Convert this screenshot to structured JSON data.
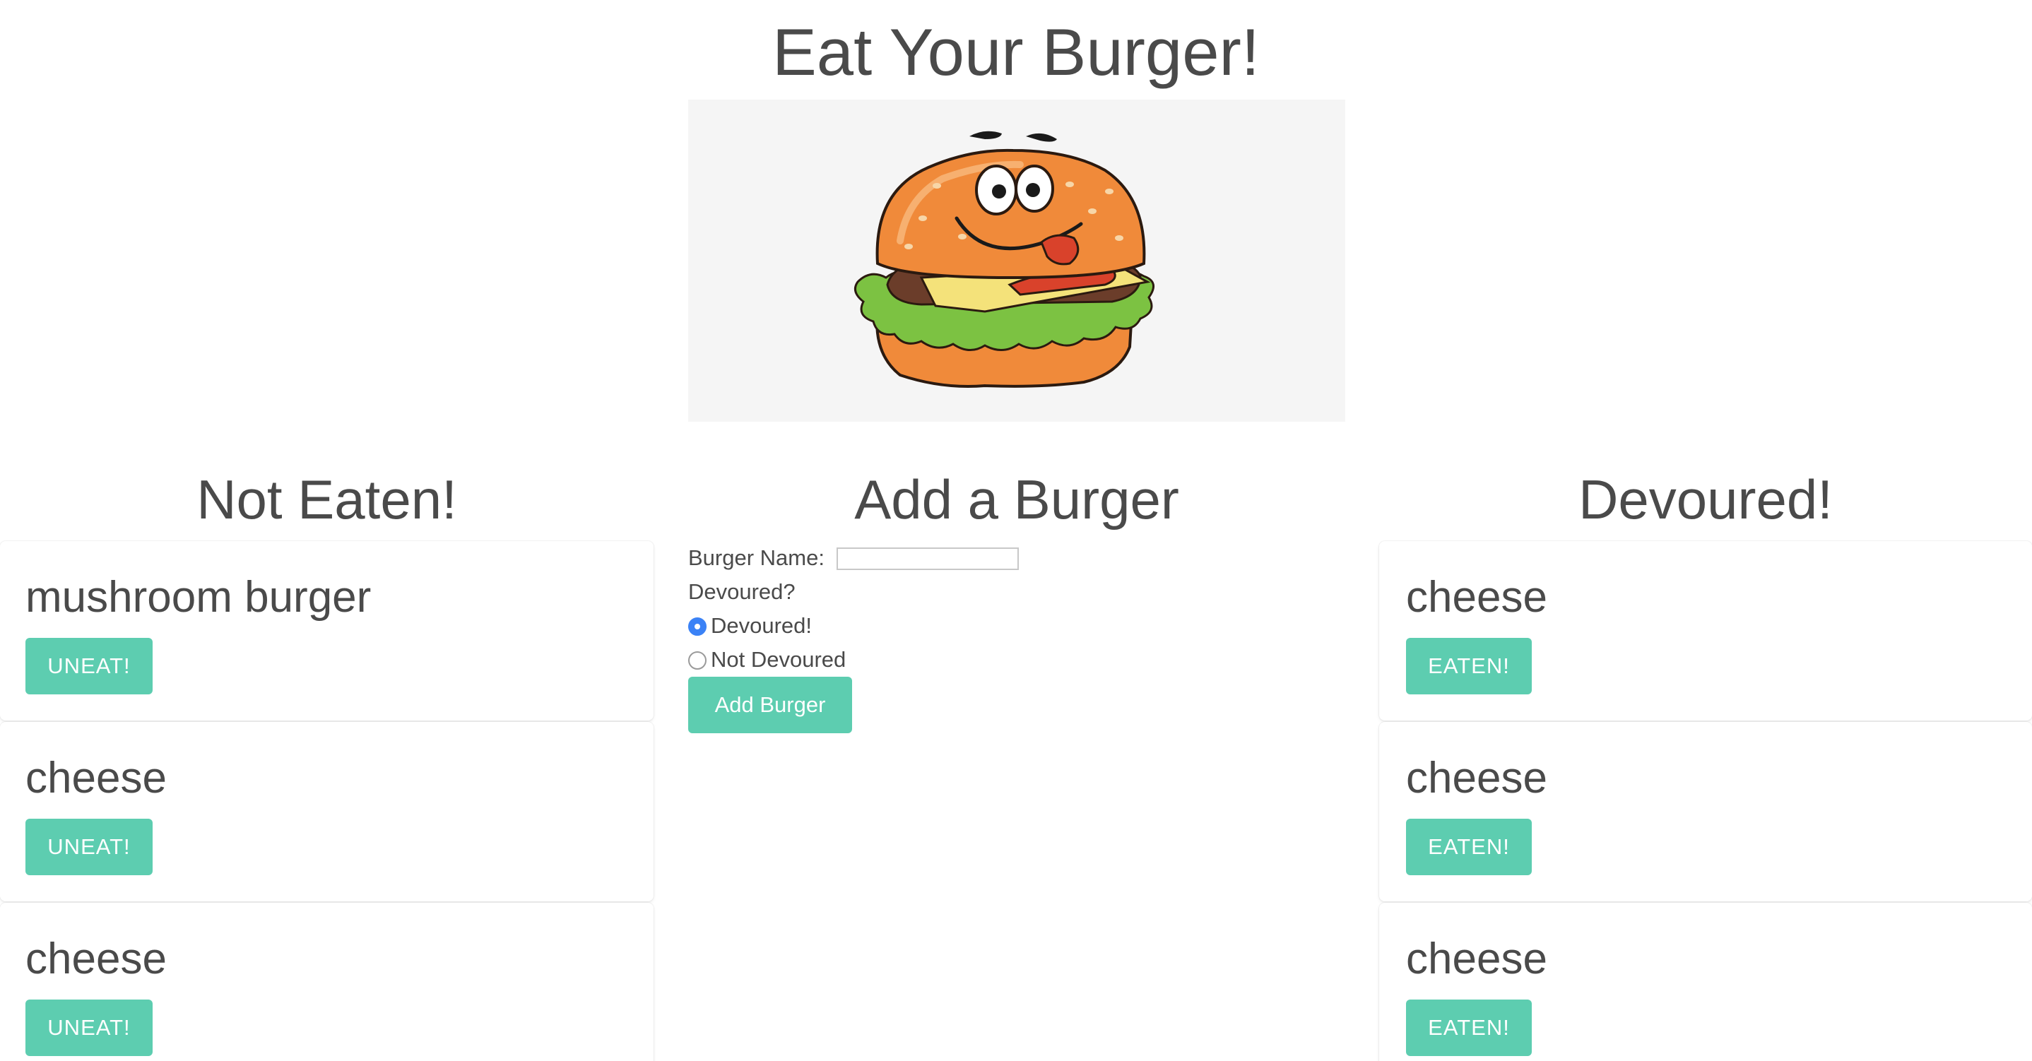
{
  "header": {
    "title": "Eat Your Burger!"
  },
  "not_eaten": {
    "title": "Not Eaten!",
    "items": [
      {
        "name": "mushroom burger",
        "button": "UNEAT!"
      },
      {
        "name": "cheese",
        "button": "UNEAT!"
      },
      {
        "name": "cheese",
        "button": "UNEAT!"
      }
    ]
  },
  "add_burger": {
    "title": "Add a Burger",
    "name_label": "Burger Name:",
    "name_value": "",
    "devoured_question": "Devoured?",
    "options": [
      {
        "label": "Devoured!",
        "checked": true
      },
      {
        "label": "Not Devoured",
        "checked": false
      }
    ],
    "submit_label": "Add Burger"
  },
  "devoured": {
    "title": "Devoured!",
    "items": [
      {
        "name": "cheese",
        "button": "EATEN!"
      },
      {
        "name": "cheese",
        "button": "EATEN!"
      },
      {
        "name": "cheese",
        "button": "EATEN!"
      }
    ]
  },
  "colors": {
    "button": "#5dcdb0",
    "text": "#4a4a4a",
    "radio_checked": "#3b82f6",
    "hero_background": "#f5f5f5"
  },
  "icons": {
    "hero": "cartoon-burger-illustration"
  }
}
